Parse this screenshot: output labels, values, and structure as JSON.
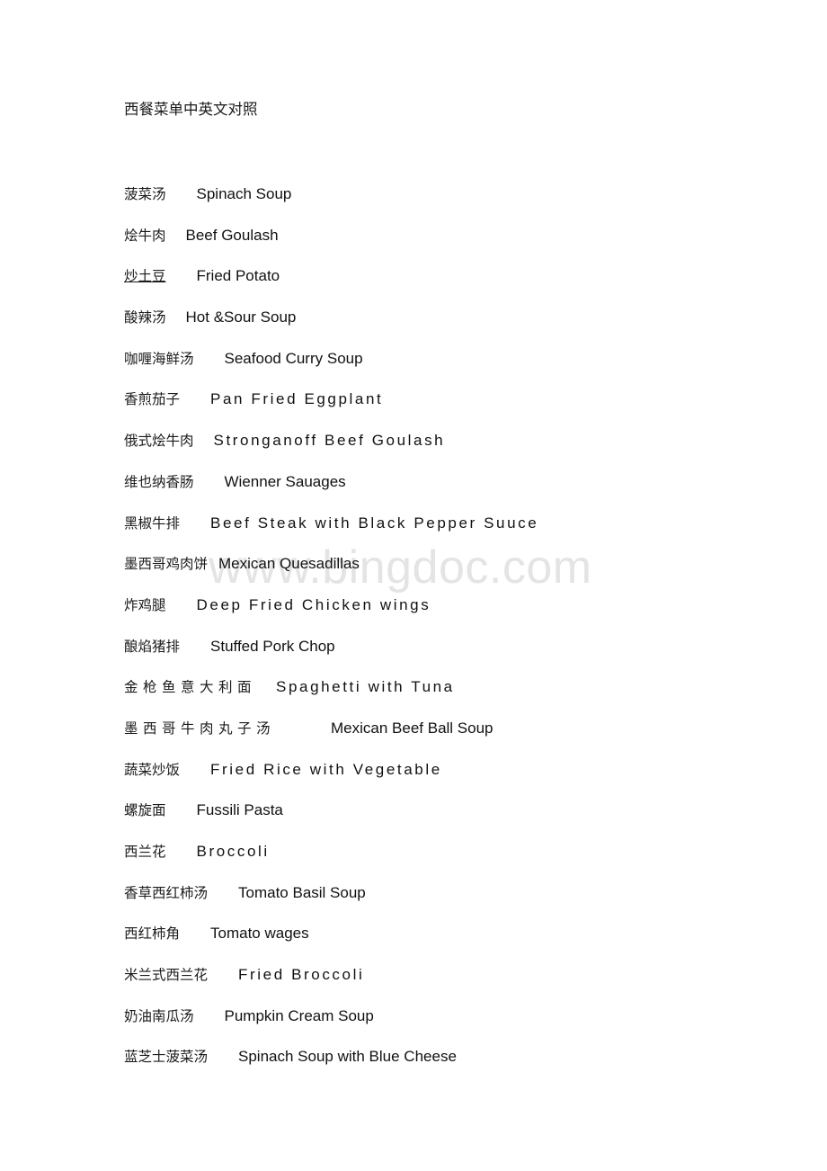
{
  "document": {
    "title": "西餐菜单中英文对照",
    "watermark": "www.bingdoc.com",
    "watermark_color": "#e4e4e4",
    "page_background": "#ffffff",
    "text_color": "#1c1c1c"
  },
  "menu": {
    "entries": [
      {
        "cn": "菠菜汤",
        "en": "Spinach Soup"
      },
      {
        "cn": "烩牛肉",
        "en": "Beef Goulash"
      },
      {
        "cn": "炒土豆",
        "en": "Fried Potato"
      },
      {
        "cn": "酸辣汤",
        "en": "Hot &Sour Soup"
      },
      {
        "cn": "咖喱海鲜汤",
        "en": "Seafood Curry Soup"
      },
      {
        "cn": "香煎茄子",
        "en": "Pan Fried Eggplant"
      },
      {
        "cn": "俄式烩牛肉",
        "en": "Stronganoff Beef Goulash"
      },
      {
        "cn": "维也纳香肠",
        "en": "Wienner Sauages"
      },
      {
        "cn": "黑椒牛排",
        "en": "Beef Steak with Black Pepper Suuce"
      },
      {
        "cn": "墨西哥鸡肉饼",
        "en": "Mexican Quesadillas"
      },
      {
        "cn": "炸鸡腿",
        "en": "Deep Fried Chicken wings"
      },
      {
        "cn": "酿焰猪排",
        "en": "Stuffed Pork Chop"
      },
      {
        "cn": "金枪鱼意大利面",
        "en": "Spaghetti with Tuna"
      },
      {
        "cn": "墨西哥牛肉丸子汤",
        "en": "Mexican Beef Ball Soup"
      },
      {
        "cn": "蔬菜炒饭",
        "en": "Fried Rice with Vegetable"
      },
      {
        "cn": "螺旋面",
        "en": "Fussili Pasta"
      },
      {
        "cn": "西兰花",
        "en": "Broccoli"
      },
      {
        "cn": "香草西红柿汤",
        "en": "Tomato Basil Soup"
      },
      {
        "cn": "西红柿角",
        "en": "Tomato wages"
      },
      {
        "cn": "米兰式西兰花",
        "en": "Fried Broccoli"
      },
      {
        "cn": "奶油南瓜汤",
        "en": "Pumpkin Cream Soup"
      },
      {
        "cn": "蓝芝士菠菜汤",
        "en": "Spinach Soup with Blue Cheese"
      }
    ]
  }
}
